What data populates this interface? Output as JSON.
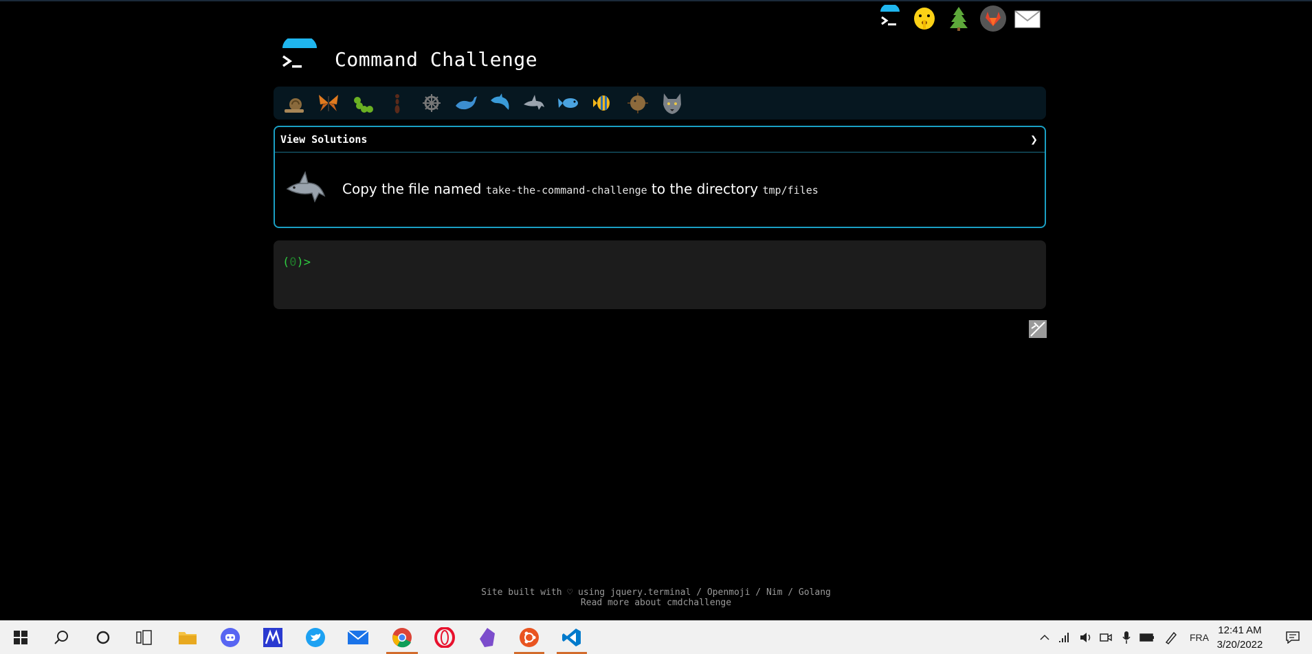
{
  "header": {
    "title": "Command Challenge",
    "top_icons": [
      "terminal-icon",
      "shushing-face-icon",
      "tree-icon",
      "gitlab-icon",
      "envelope-icon"
    ]
  },
  "levels": [
    "snail",
    "butterfly",
    "caterpillar",
    "ant",
    "ship-wheel",
    "whale",
    "dolphin",
    "shark",
    "fish",
    "tropical-fish",
    "blowfish",
    "wolf"
  ],
  "challenge": {
    "solutions_label": "View Solutions",
    "chevron": "❯",
    "task_prefix": "Copy the file named",
    "task_file": "take-the-command-challenge",
    "task_middle": "to the directory",
    "task_dir": "tmp/files"
  },
  "terminal": {
    "prompt_open": "(",
    "prompt_num": "0",
    "prompt_close": ")>"
  },
  "footer": {
    "line1": "Site built with ♡ using jquery.terminal / Openmoji / Nim / Golang",
    "line2": "Read more about cmdchallenge"
  },
  "taskbar": {
    "time": "12:41 AM",
    "date": "3/20/2022",
    "language": "FRA"
  },
  "colors": {
    "accent_border": "#1aa0c4",
    "level_bar_bg": "#061720",
    "terminal_bg": "#1c1c1c",
    "prompt_green": "#2ecc40",
    "taskbar_bg": "#f1f1f1"
  }
}
